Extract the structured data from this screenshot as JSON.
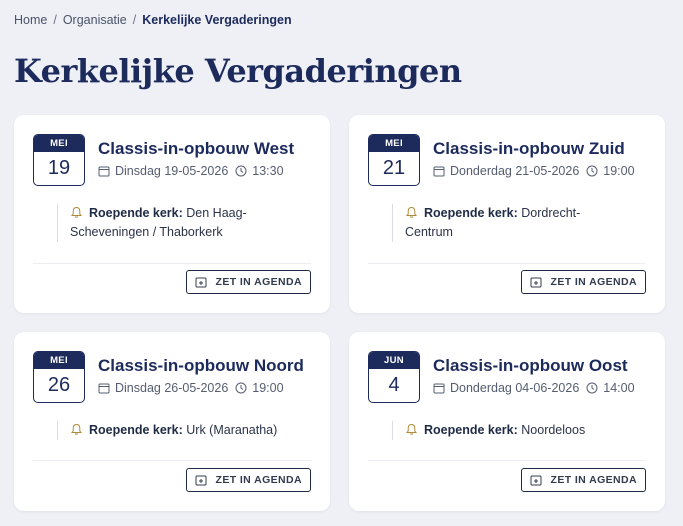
{
  "breadcrumb": {
    "home": "Home",
    "organisatie": "Organisatie",
    "current": "Kerkelijke Vergaderingen",
    "separator": "/"
  },
  "page_title": "Kerkelijke Vergaderingen",
  "caller_label": "Roepende kerk:",
  "agenda_label": "ZET IN AGENDA",
  "colors": {
    "accent": "#1c2a5c",
    "background": "#eef0f6",
    "card": "#ffffff"
  },
  "meetings": [
    {
      "month": "MEI",
      "day": "19",
      "title": "Classis-in-opbouw West",
      "date": "Dinsdag 19-05-2026",
      "time": "13:30",
      "caller_line1": "Den Haag-",
      "caller_line2": "Scheveningen / Thaborkerk"
    },
    {
      "month": "MEI",
      "day": "21",
      "title": "Classis-in-opbouw Zuid",
      "date": "Donderdag 21-05-2026",
      "time": "19:00",
      "caller_line1": "Dordrecht-",
      "caller_line2": "Centrum"
    },
    {
      "month": "MEI",
      "day": "26",
      "title": "Classis-in-opbouw Noord",
      "date": "Dinsdag 26-05-2026",
      "time": "19:00",
      "caller_line1": "Urk (Maranatha)",
      "caller_line2": ""
    },
    {
      "month": "JUN",
      "day": "4",
      "title": "Classis-in-opbouw Oost",
      "date": "Donderdag 04-06-2026",
      "time": "14:00",
      "caller_line1": "Noordeloos",
      "caller_line2": ""
    }
  ]
}
